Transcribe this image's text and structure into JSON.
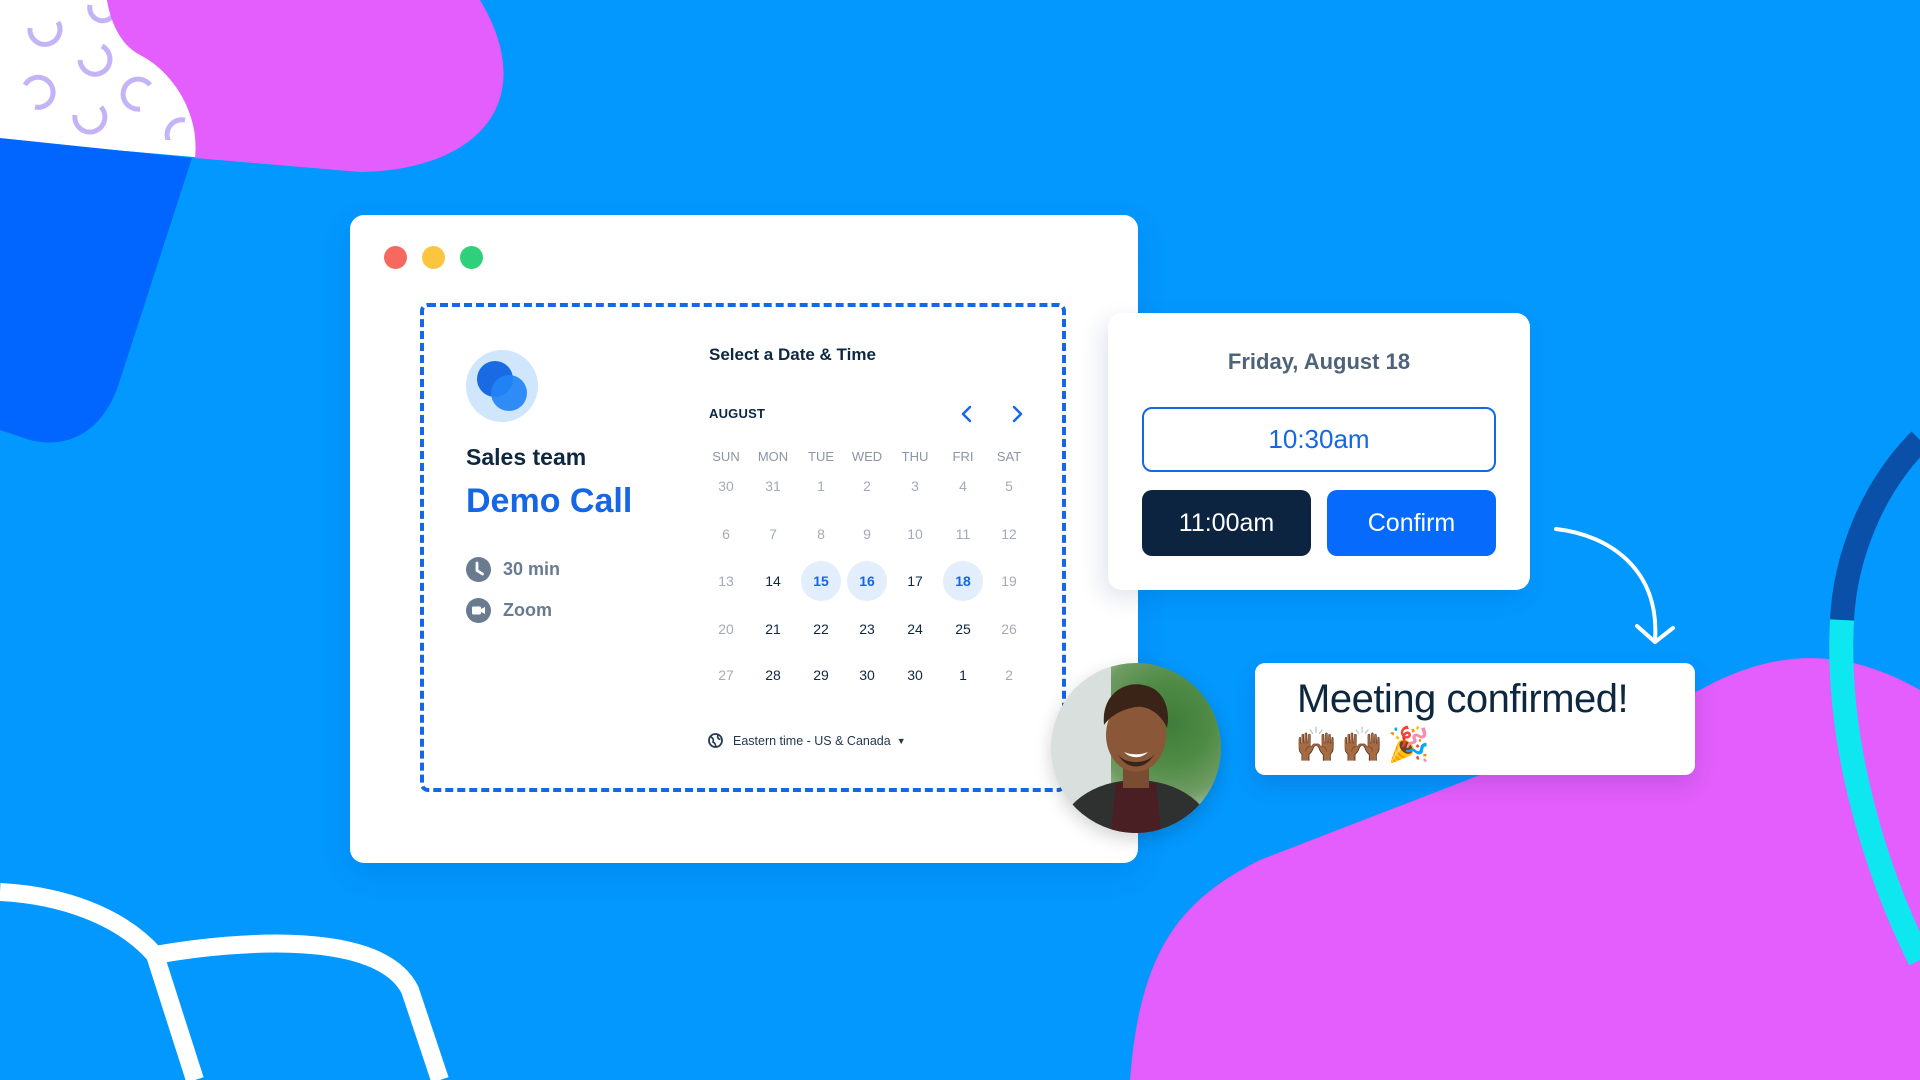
{
  "window": {
    "controls": [
      "close",
      "minimize",
      "maximize"
    ]
  },
  "event": {
    "team": "Sales team",
    "name": "Demo Call",
    "duration": "30 min",
    "location": "Zoom",
    "duration_icon": "clock-icon",
    "location_icon": "video-camera-icon"
  },
  "calendar": {
    "title": "Select a Date & Time",
    "month": "AUGUST",
    "prev_icon": "chevron-left-icon",
    "next_icon": "chevron-right-icon",
    "weekdays": [
      "SUN",
      "MON",
      "TUE",
      "WED",
      "THU",
      "FRI",
      "SAT"
    ],
    "weeks": [
      [
        {
          "d": "30",
          "s": "muted"
        },
        {
          "d": "31",
          "s": "muted"
        },
        {
          "d": "1",
          "s": "muted"
        },
        {
          "d": "2",
          "s": "muted"
        },
        {
          "d": "3",
          "s": "muted"
        },
        {
          "d": "4",
          "s": "muted"
        },
        {
          "d": "5",
          "s": "muted"
        }
      ],
      [
        {
          "d": "6",
          "s": "muted"
        },
        {
          "d": "7",
          "s": "muted"
        },
        {
          "d": "8",
          "s": "muted"
        },
        {
          "d": "9",
          "s": "muted"
        },
        {
          "d": "10",
          "s": "muted"
        },
        {
          "d": "11",
          "s": "muted"
        },
        {
          "d": "12",
          "s": "muted"
        }
      ],
      [
        {
          "d": "13",
          "s": "muted"
        },
        {
          "d": "14",
          "s": "available"
        },
        {
          "d": "15",
          "s": "highlight"
        },
        {
          "d": "16",
          "s": "highlight"
        },
        {
          "d": "17",
          "s": "available"
        },
        {
          "d": "18",
          "s": "highlight"
        },
        {
          "d": "19",
          "s": "muted"
        }
      ],
      [
        {
          "d": "20",
          "s": "muted"
        },
        {
          "d": "21",
          "s": "available"
        },
        {
          "d": "22",
          "s": "available"
        },
        {
          "d": "23",
          "s": "available"
        },
        {
          "d": "24",
          "s": "available"
        },
        {
          "d": "25",
          "s": "available"
        },
        {
          "d": "26",
          "s": "muted"
        }
      ],
      [
        {
          "d": "27",
          "s": "muted"
        },
        {
          "d": "28",
          "s": "available"
        },
        {
          "d": "29",
          "s": "available"
        },
        {
          "d": "30",
          "s": "available"
        },
        {
          "d": "30",
          "s": "available"
        },
        {
          "d": "1",
          "s": "available"
        },
        {
          "d": "2",
          "s": "muted"
        }
      ]
    ],
    "timezone": "Eastern time - US & Canada",
    "timezone_icon": "globe-icon"
  },
  "time_picker": {
    "date": "Friday, August 18",
    "slots": [
      "10:30am",
      "11:00am"
    ],
    "confirm_label": "Confirm"
  },
  "confirmation": {
    "message": "Meeting confirmed!",
    "emoji": "🙌🏾🙌🏾🎉"
  },
  "colors": {
    "background": "#0398fe",
    "accent": "#1567e6",
    "confirm": "#066bfc",
    "dark": "#0d2440",
    "pink": "#e35efc",
    "highlight_bg": "#e2eefc"
  }
}
